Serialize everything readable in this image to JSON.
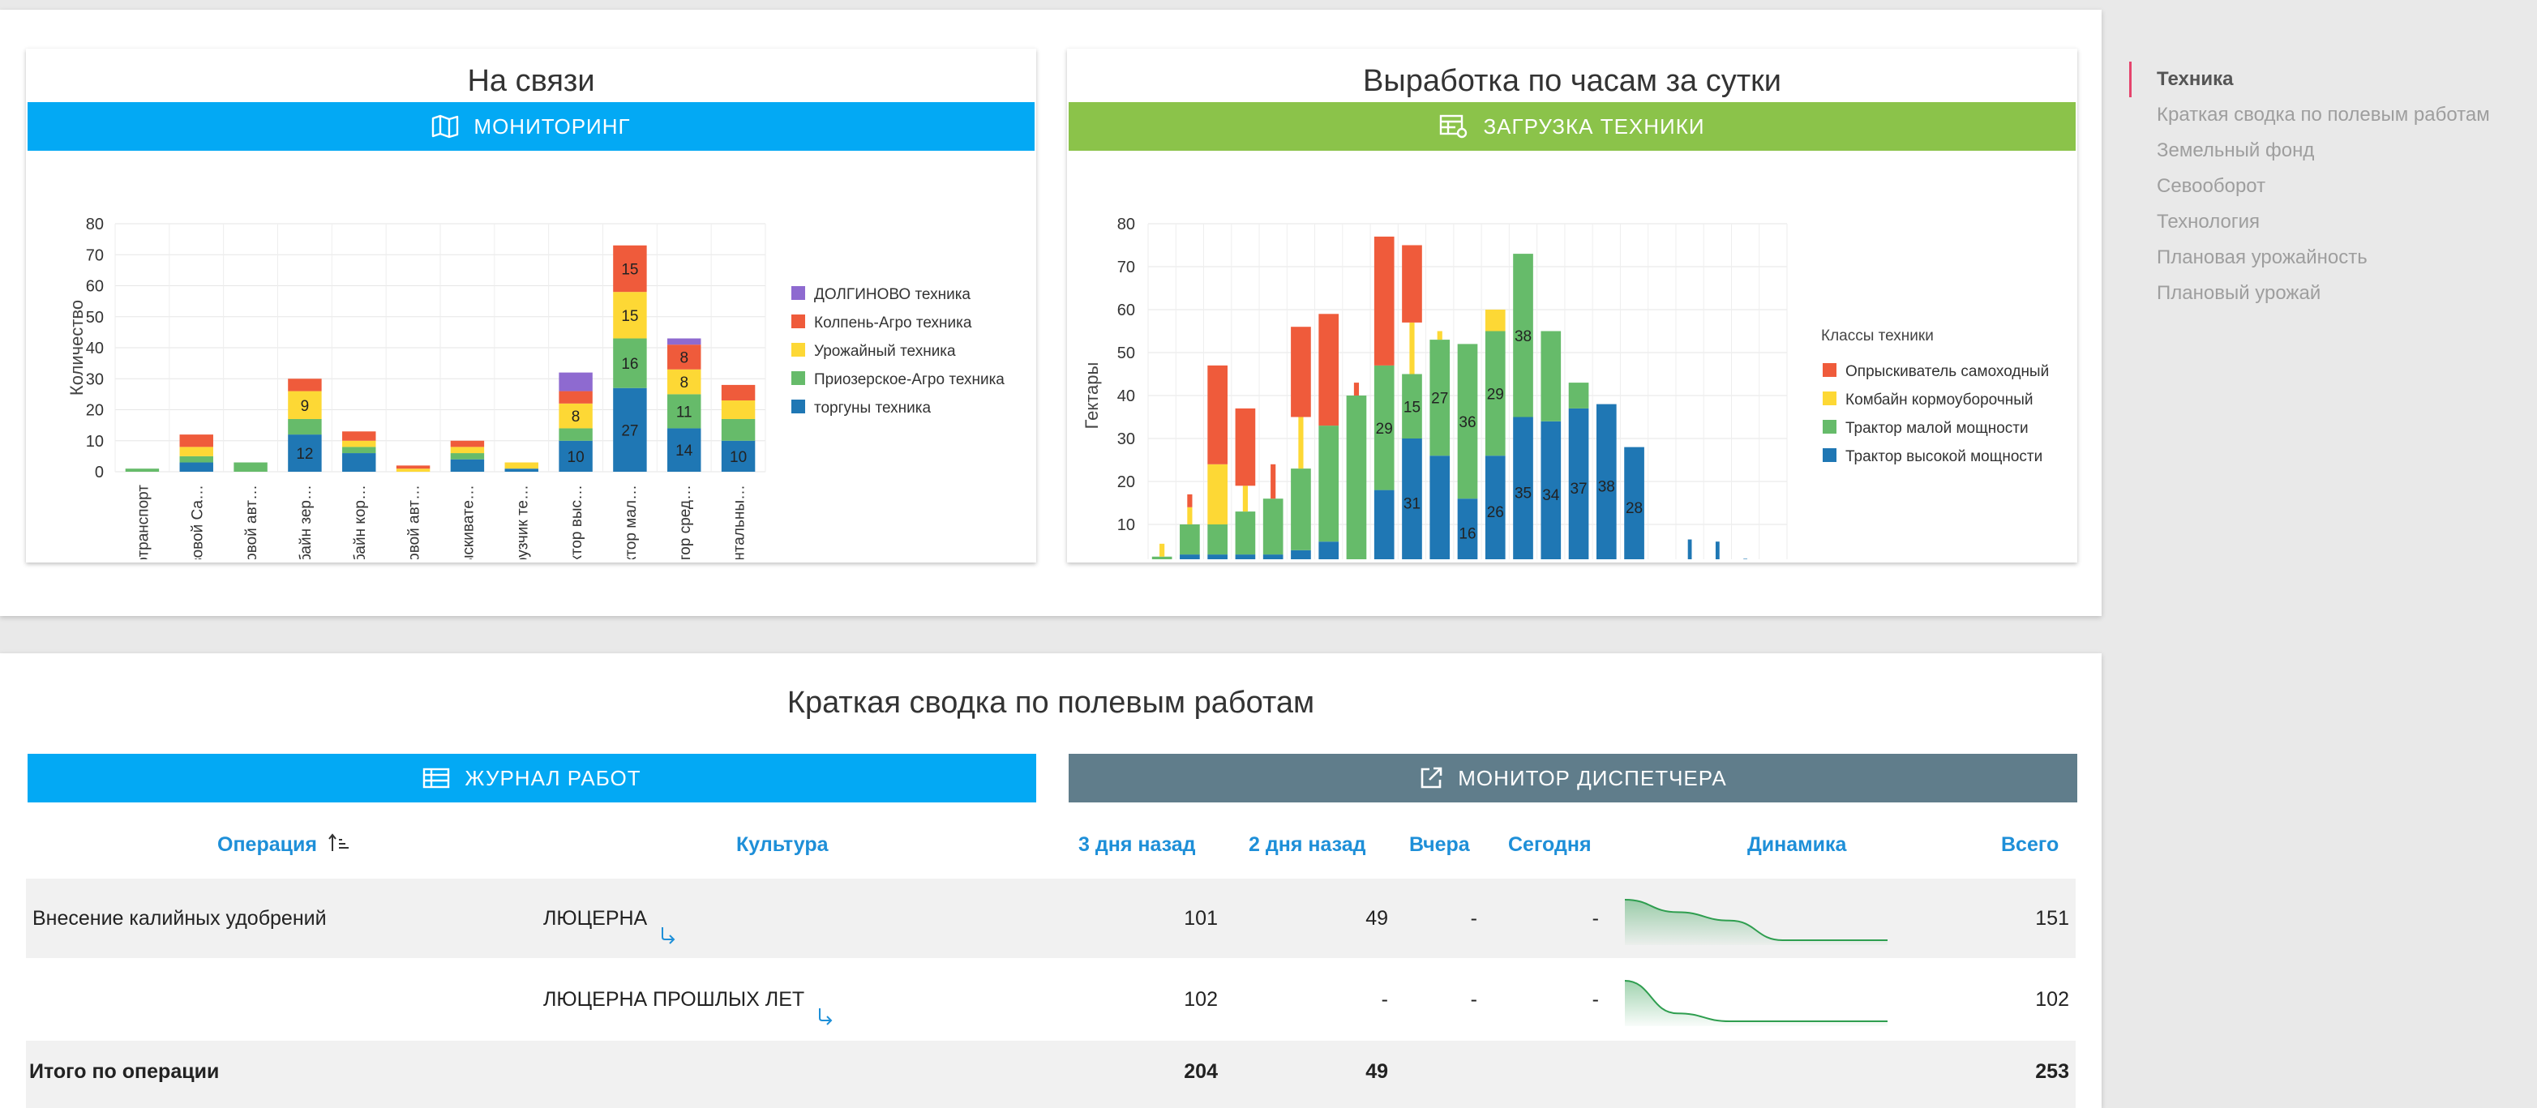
{
  "nav": {
    "items": [
      {
        "label": "Техника",
        "active": true
      },
      {
        "label": "Краткая сводка по полевым работам",
        "active": false
      },
      {
        "label": "Земельный фонд",
        "active": false
      },
      {
        "label": "Севооборот",
        "active": false
      },
      {
        "label": "Технология",
        "active": false
      },
      {
        "label": "Плановая урожайность",
        "active": false
      },
      {
        "label": "Плановый урожай",
        "active": false
      }
    ]
  },
  "cards": {
    "comm": {
      "title": "На связи",
      "button": "МОНИТОРИНГ"
    },
    "output": {
      "title": "Выработка по часам за сутки",
      "button": "ЗАГРУЗКА ТЕХНИКИ"
    }
  },
  "summary": {
    "title": "Краткая сводка по полевым работам",
    "journal_button": "ЖУРНАЛ РАБОТ",
    "dispatcher_button": "МОНИТОР ДИСПЕТЧЕРА",
    "columns": {
      "operation": "Операция",
      "culture": "Культура",
      "d3": "3 дня назад",
      "d2": "2 дня назад",
      "d1": "Вчера",
      "today": "Сегодня",
      "dynamics": "Динамика",
      "total": "Всего"
    },
    "rows": [
      {
        "operation": "Внесение калийных удобрений",
        "culture": "ЛЮЦЕРНА",
        "d3": "101",
        "d2": "49",
        "d1": "-",
        "today": "-",
        "total": "151",
        "spark": [
          101,
          70,
          49,
          0,
          0,
          0
        ]
      },
      {
        "operation": "",
        "culture": "ЛЮЦЕРНА ПРОШЛЫХ ЛЕТ",
        "d3": "102",
        "d2": "-",
        "d1": "-",
        "today": "-",
        "total": "102",
        "spark": [
          102,
          20,
          0,
          0,
          0,
          0
        ]
      }
    ],
    "total_row": {
      "label": "Итого по операции",
      "d3": "204",
      "d2": "49",
      "total": "253"
    }
  },
  "chart_data": [
    {
      "type": "bar",
      "stacked": true,
      "ylabel": "Количество",
      "ylim": [
        0,
        80
      ],
      "yticks": [
        0,
        10,
        20,
        30,
        40,
        50,
        60,
        70,
        80
      ],
      "categories": [
        "Автотранспорт",
        "Грузовой Са…",
        "Грузовой авт…",
        "Комбайн зер…",
        "Комбайн кор…",
        "Легковой авт…",
        "Опрыскивате…",
        "Погрузчик те…",
        "Трактор выс…",
        "Трактор мал…",
        "Трактор сред…",
        "Фронтальны…"
      ],
      "legend_placement": "right",
      "series": [
        {
          "name": "торгуны техника",
          "color": "#1f77b4",
          "values": [
            0,
            3,
            0,
            12,
            6,
            0,
            4,
            1,
            10,
            27,
            14,
            10
          ]
        },
        {
          "name": "Приозерское-Агро техника",
          "color": "#66bb6a",
          "values": [
            1,
            2,
            3,
            5,
            2,
            0,
            2,
            0,
            4,
            16,
            11,
            7
          ]
        },
        {
          "name": "Урожайный техника",
          "color": "#fdd835",
          "values": [
            0,
            3,
            0,
            9,
            2,
            1,
            2,
            2,
            8,
            15,
            8,
            6
          ]
        },
        {
          "name": "Колпень-Агро техника",
          "color": "#ef5b3b",
          "values": [
            0,
            4,
            0,
            4,
            3,
            1,
            2,
            0,
            4,
            15,
            8,
            5
          ]
        },
        {
          "name": "ДОЛГИНОВО техника",
          "color": "#8e6ad0",
          "values": [
            0,
            0,
            0,
            0,
            0,
            0,
            0,
            0,
            6,
            0,
            2,
            0
          ]
        }
      ],
      "data_labels": [
        {
          "category": "Комбайн зер…",
          "series": "торгуны техника",
          "label": "12"
        },
        {
          "category": "Комбайн зер…",
          "series": "Урожайный техника",
          "label": "9"
        },
        {
          "category": "Трактор выс…",
          "series": "торгуны техника",
          "label": "10"
        },
        {
          "category": "Трактор выс…",
          "series": "Урожайный техника",
          "label": "8"
        },
        {
          "category": "Трактор мал…",
          "series": "торгуны техника",
          "label": "27"
        },
        {
          "category": "Трактор мал…",
          "series": "Приозерское-Агро техника",
          "label": "16"
        },
        {
          "category": "Трактор мал…",
          "series": "Урожайный техника",
          "label": "15"
        },
        {
          "category": "Трактор мал…",
          "series": "Колпень-Агро техника",
          "label": "15"
        },
        {
          "category": "Трактор сред…",
          "series": "торгуны техника",
          "label": "14"
        },
        {
          "category": "Трактор сред…",
          "series": "Приозерское-Агро техника",
          "label": "11"
        },
        {
          "category": "Трактор сред…",
          "series": "Урожайный техника",
          "label": "8"
        },
        {
          "category": "Трактор сред…",
          "series": "Колпень-Агро техника",
          "label": "8"
        },
        {
          "category": "Фронтальны…",
          "series": "торгуны техника",
          "label": "10"
        }
      ]
    },
    {
      "type": "bar",
      "stacked": true,
      "ylabel": "Гектары",
      "ylim": [
        0,
        80
      ],
      "yticks": [
        0,
        10,
        20,
        30,
        40,
        50,
        60,
        70,
        80
      ],
      "xlim": [
        0,
        23
      ],
      "xticks": [
        0,
        2,
        4,
        6,
        8,
        10,
        12,
        14,
        16,
        18,
        20,
        22
      ],
      "legend_title": "Классы техники",
      "legend_placement": "right",
      "series": [
        {
          "name": "Трактор высокой мощности",
          "color": "#1f77b4",
          "points": [
            [
              0,
              0.5
            ],
            [
              1,
              3
            ],
            [
              2,
              3
            ],
            [
              3,
              3
            ],
            [
              4,
              3
            ],
            [
              5,
              4
            ],
            [
              6,
              6
            ],
            [
              7,
              0
            ],
            [
              8,
              18
            ],
            [
              9,
              30
            ],
            [
              10,
              26
            ],
            [
              11,
              16
            ],
            [
              12,
              26
            ],
            [
              13,
              35
            ],
            [
              14,
              34
            ],
            [
              15,
              37
            ],
            [
              16,
              38
            ],
            [
              17,
              28
            ],
            [
              18,
              0.5
            ],
            [
              19,
              6.5
            ],
            [
              20,
              6
            ],
            [
              21,
              2
            ]
          ]
        },
        {
          "name": "Трактор малой мощности",
          "color": "#66bb6a",
          "points": [
            [
              0,
              2
            ],
            [
              1,
              7
            ],
            [
              2,
              7
            ],
            [
              3,
              10
            ],
            [
              4,
              13
            ],
            [
              5,
              19
            ],
            [
              6,
              27
            ],
            [
              7,
              40
            ],
            [
              8,
              29
            ],
            [
              9,
              15
            ],
            [
              10,
              27
            ],
            [
              11,
              36
            ],
            [
              12,
              29
            ],
            [
              13,
              38
            ],
            [
              14,
              21
            ],
            [
              15,
              6
            ],
            [
              16,
              0
            ],
            [
              17,
              0
            ],
            [
              18,
              0
            ],
            [
              19,
              0
            ],
            [
              20,
              0
            ],
            [
              21,
              0
            ]
          ]
        },
        {
          "name": "Комбайн кормоуборочный",
          "color": "#fdd835",
          "points": [
            [
              0,
              3
            ],
            [
              1,
              4
            ],
            [
              2,
              14
            ],
            [
              3,
              6
            ],
            [
              4,
              0
            ],
            [
              5,
              12
            ],
            [
              6,
              0
            ],
            [
              7,
              0
            ],
            [
              8,
              0
            ],
            [
              9,
              12
            ],
            [
              10,
              2
            ],
            [
              11,
              0
            ],
            [
              12,
              5
            ],
            [
              13,
              0
            ],
            [
              14,
              0
            ],
            [
              15,
              0
            ],
            [
              16,
              0
            ],
            [
              17,
              0
            ],
            [
              18,
              0
            ],
            [
              19,
              0
            ],
            [
              20,
              0
            ],
            [
              21,
              0
            ]
          ]
        },
        {
          "name": "Опрыскиватель самоходный",
          "color": "#ef5b3b",
          "points": [
            [
              0,
              0
            ],
            [
              1,
              3
            ],
            [
              2,
              23
            ],
            [
              3,
              18
            ],
            [
              4,
              8
            ],
            [
              5,
              21
            ],
            [
              6,
              26
            ],
            [
              7,
              3
            ],
            [
              8,
              30
            ],
            [
              9,
              18
            ],
            [
              10,
              0
            ],
            [
              11,
              0
            ],
            [
              12,
              0
            ],
            [
              13,
              0
            ],
            [
              14,
              0
            ],
            [
              15,
              0
            ],
            [
              16,
              0
            ],
            [
              17,
              0
            ],
            [
              18,
              0
            ],
            [
              19,
              0
            ],
            [
              20,
              0
            ],
            [
              21,
              0
            ]
          ]
        }
      ],
      "data_labels": [
        {
          "x": 8,
          "series": "Трактор малой мощности",
          "label": "29"
        },
        {
          "x": 9,
          "series": "Трактор высокой мощности",
          "label": "31"
        },
        {
          "x": 9,
          "series": "Трактор малой мощности",
          "label": "15"
        },
        {
          "x": 10,
          "series": "Трактор малой мощности",
          "label": "27"
        },
        {
          "x": 11,
          "series": "Трактор высокой мощности",
          "label": "16"
        },
        {
          "x": 11,
          "series": "Трактор малой мощности",
          "label": "36"
        },
        {
          "x": 12,
          "series": "Трактор высокой мощности",
          "label": "26"
        },
        {
          "x": 12,
          "series": "Трактор малой мощности",
          "label": "29"
        },
        {
          "x": 13,
          "series": "Трактор высокой мощности",
          "label": "35"
        },
        {
          "x": 13,
          "series": "Трактор малой мощности",
          "label": "38"
        },
        {
          "x": 14,
          "series": "Трактор высокой мощности",
          "label": "34"
        },
        {
          "x": 15,
          "series": "Трактор высокой мощности",
          "label": "37"
        },
        {
          "x": 16,
          "series": "Трактор высокой мощности",
          "label": "38"
        },
        {
          "x": 17,
          "series": "Трактор высокой мощности",
          "label": "28"
        }
      ]
    }
  ]
}
